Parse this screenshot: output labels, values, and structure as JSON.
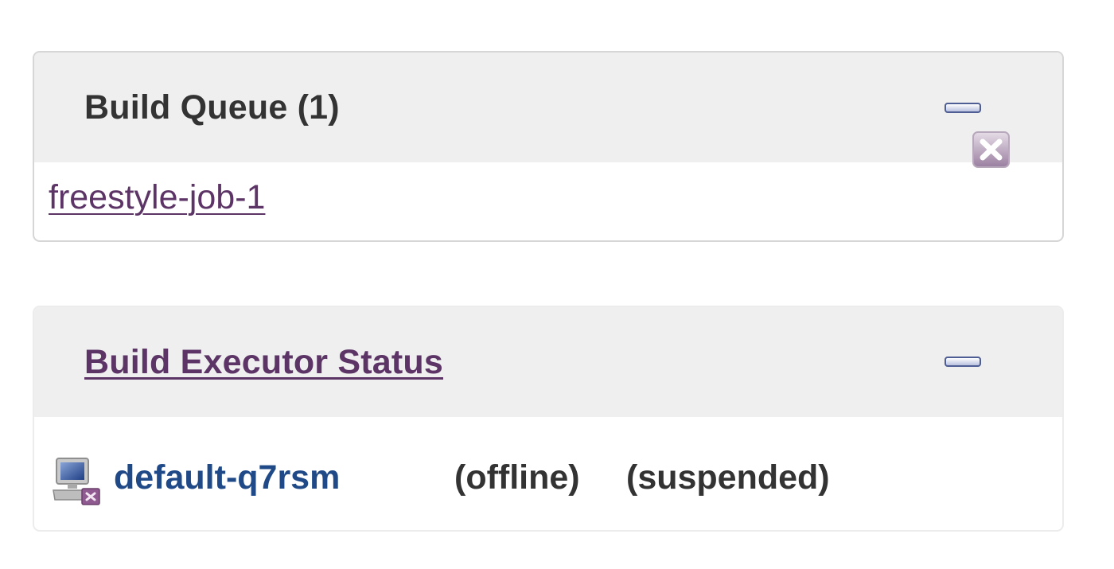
{
  "build_queue": {
    "title": "Build Queue (1)",
    "items": [
      {
        "label": "freestyle-job-1"
      }
    ]
  },
  "executor_status": {
    "title": "Build Executor Status",
    "nodes": [
      {
        "name": "default-q7rsm",
        "statuses": [
          "(offline)",
          "(suspended)"
        ]
      }
    ]
  },
  "icons": {
    "collapse": "collapse-icon",
    "cancel": "cancel-icon",
    "computer": "computer-offline-icon"
  },
  "colors": {
    "link_visited": "#5c3566",
    "node_link": "#204a87",
    "header_bg": "#efefef",
    "text": "#333333"
  }
}
